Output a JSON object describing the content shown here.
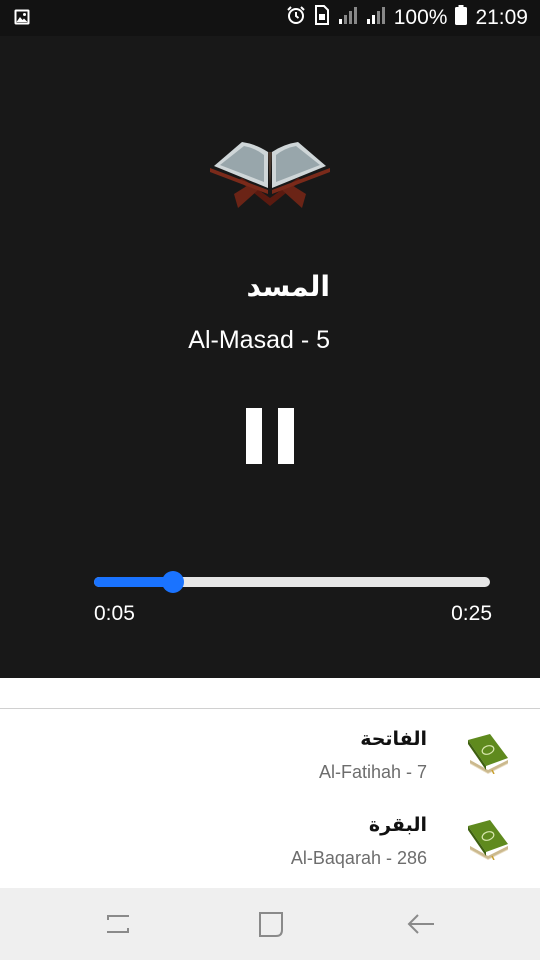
{
  "status_bar": {
    "battery_text": "100%",
    "time": "21:09"
  },
  "now_playing": {
    "surah_arabic": "المسد",
    "surah_latin": "Al-Masad - 5",
    "playback_state": "playing",
    "progress_fraction": 0.2,
    "current_time": "0:05",
    "total_time": "0:25",
    "accent_color": "#1a73ff"
  },
  "playlist": {
    "items": [
      {
        "arabic": "الفاتحة",
        "latin": "Al-Fatihah - 7",
        "icon": "quran-book-icon"
      },
      {
        "arabic": "البقرة",
        "latin": "Al-Baqarah - 286",
        "icon": "quran-book-icon"
      }
    ]
  },
  "navigation": {
    "buttons": [
      "recent-apps-icon",
      "home-icon",
      "back-icon"
    ]
  }
}
